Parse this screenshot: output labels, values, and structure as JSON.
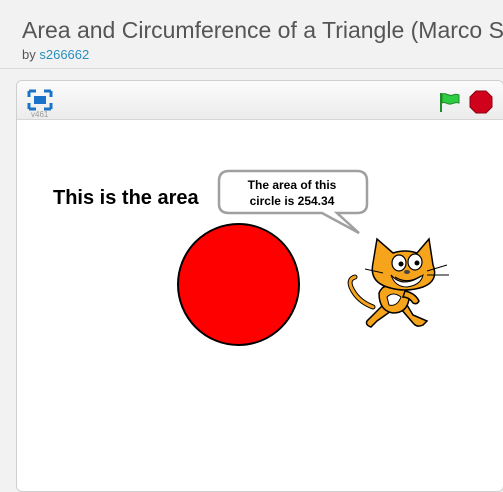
{
  "project": {
    "title": "Area and Circumference of a Triangle (Marco Stefani)",
    "by_label": "by",
    "author": "s266662"
  },
  "player": {
    "version": "v461"
  },
  "stage": {
    "heading": "This is the area",
    "speech_line1": "The area of this",
    "speech_line2": "circle is 254.34",
    "circle_color": "#ff0000"
  },
  "colors": {
    "flag": "#2ecc40",
    "stop": "#d0021b",
    "fullscreen": "#1a73c8",
    "author_link": "#2a8fbd"
  },
  "icons": {
    "fullscreen": "fullscreen-icon",
    "flag": "green-flag-icon",
    "stop": "stop-sign-icon",
    "sprite": "scratch-cat"
  }
}
